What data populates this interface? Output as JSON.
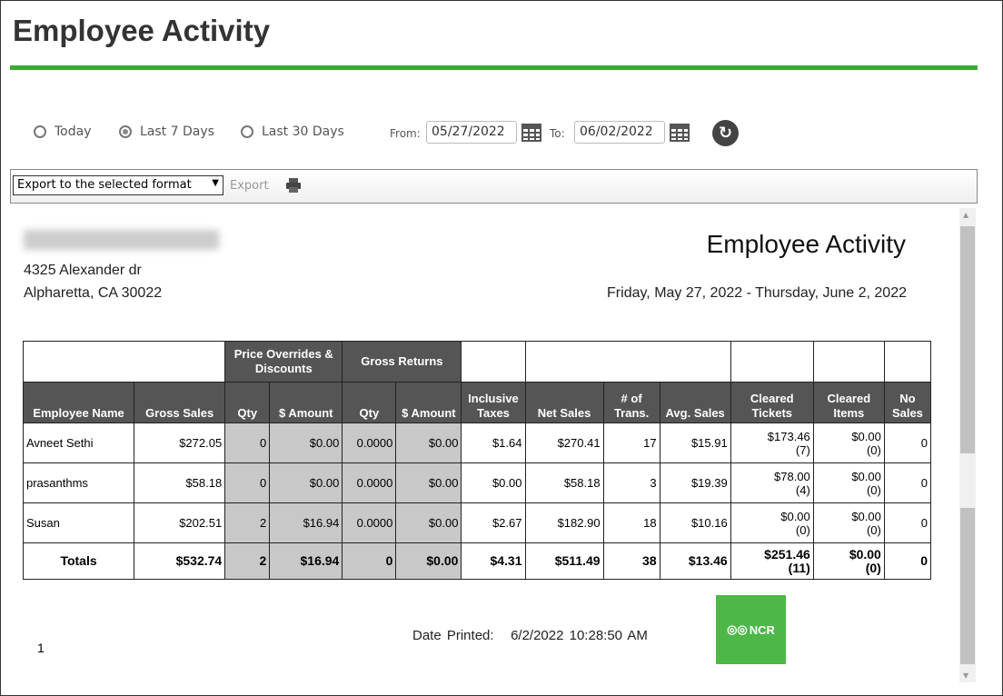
{
  "page": {
    "title": "Employee Activity"
  },
  "filters": {
    "options": [
      {
        "label": "Today",
        "selected": false
      },
      {
        "label": "Last 7 Days",
        "selected": true
      },
      {
        "label": "Last 30 Days",
        "selected": false
      }
    ],
    "from_label": "From:",
    "from_value": "05/27/2022",
    "to_label": "To:",
    "to_value": "06/02/2022"
  },
  "toolbar": {
    "export_select": "Export to the selected format",
    "export_label": "Export"
  },
  "report": {
    "address1": "4325 Alexander dr",
    "address2": "Alpharetta, CA 30022",
    "title": "Employee Activity",
    "date_range": "Friday, May 27, 2022 - Thursday, June 2, 2022",
    "group_headers": {
      "price_overrides": "Price Overrides & Discounts",
      "gross_returns": "Gross Returns"
    },
    "columns": [
      "Employee Name",
      "Gross Sales",
      "Qty",
      "$ Amount",
      "Qty",
      "$ Amount",
      "Inclusive Taxes",
      "Net Sales",
      "# of Trans.",
      "Avg. Sales",
      "Cleared Tickets",
      "Cleared Items",
      "No Sales"
    ],
    "rows": [
      [
        "Avneet Sethi",
        "$272.05",
        "0",
        "$0.00",
        "0.0000",
        "$0.00",
        "$1.64",
        "$270.41",
        "17",
        "$15.91",
        "$173.46 (7)",
        "$0.00 (0)",
        "0"
      ],
      [
        "prasanthms",
        "$58.18",
        "0",
        "$0.00",
        "0.0000",
        "$0.00",
        "$0.00",
        "$58.18",
        "3",
        "$19.39",
        "$78.00 (4)",
        "$0.00 (0)",
        "0"
      ],
      [
        "Susan",
        "$202.51",
        "2",
        "$16.94",
        "0.0000",
        "$0.00",
        "$2.67",
        "$182.90",
        "18",
        "$10.16",
        "$0.00 (0)",
        "$0.00 (0)",
        "0"
      ]
    ],
    "totals": [
      "Totals",
      "$532.74",
      "2",
      "$16.94",
      "0",
      "$0.00",
      "$4.31",
      "$511.49",
      "38",
      "$13.46",
      "$251.46 (11)",
      "$0.00 (0)",
      "0"
    ],
    "page_number": "1",
    "date_printed_label": "Date Printed:",
    "date_printed": "6/2/2022 10:28:50 AM",
    "logo_text": "NCR"
  },
  "colors": {
    "accent": "#3aaa35",
    "header_bg": "#555555",
    "shaded": "#c8c8c8"
  }
}
